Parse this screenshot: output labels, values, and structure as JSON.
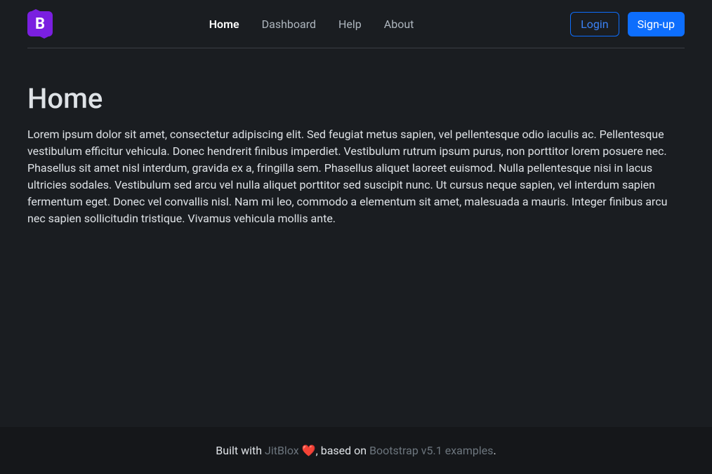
{
  "logo": {
    "letter": "B"
  },
  "nav": {
    "items": [
      {
        "label": "Home",
        "active": true
      },
      {
        "label": "Dashboard",
        "active": false
      },
      {
        "label": "Help",
        "active": false
      },
      {
        "label": "About",
        "active": false
      }
    ]
  },
  "auth": {
    "login_label": "Login",
    "signup_label": "Sign-up"
  },
  "page": {
    "title": "Home",
    "body": "Lorem ipsum dolor sit amet, consectetur adipiscing elit. Sed feugiat metus sapien, vel pellentesque odio iaculis ac. Pellentesque vestibulum efficitur vehicula. Donec hendrerit finibus imperdiet. Vestibulum rutrum ipsum purus, non porttitor lorem posuere nec. Phasellus sit amet nisl interdum, gravida ex a, fringilla sem. Phasellus aliquet laoreet euismod. Nulla pellentesque nisi in lacus ultricies sodales. Vestibulum sed arcu vel nulla aliquet porttitor sed suscipit nunc. Ut cursus neque sapien, vel interdum sapien fermentum eget. Donec vel convallis nisl. Nam mi leo, commodo a elementum sit amet, malesuada a mauris. Integer finibus arcu nec sapien sollicitudin tristique. Vivamus vehicula mollis ante."
  },
  "footer": {
    "prefix": "Built with ",
    "link1": "JitBlox",
    "heart": "❤️",
    "middle": ", based on ",
    "link2": "Bootstrap v5.1 examples",
    "suffix": "."
  }
}
